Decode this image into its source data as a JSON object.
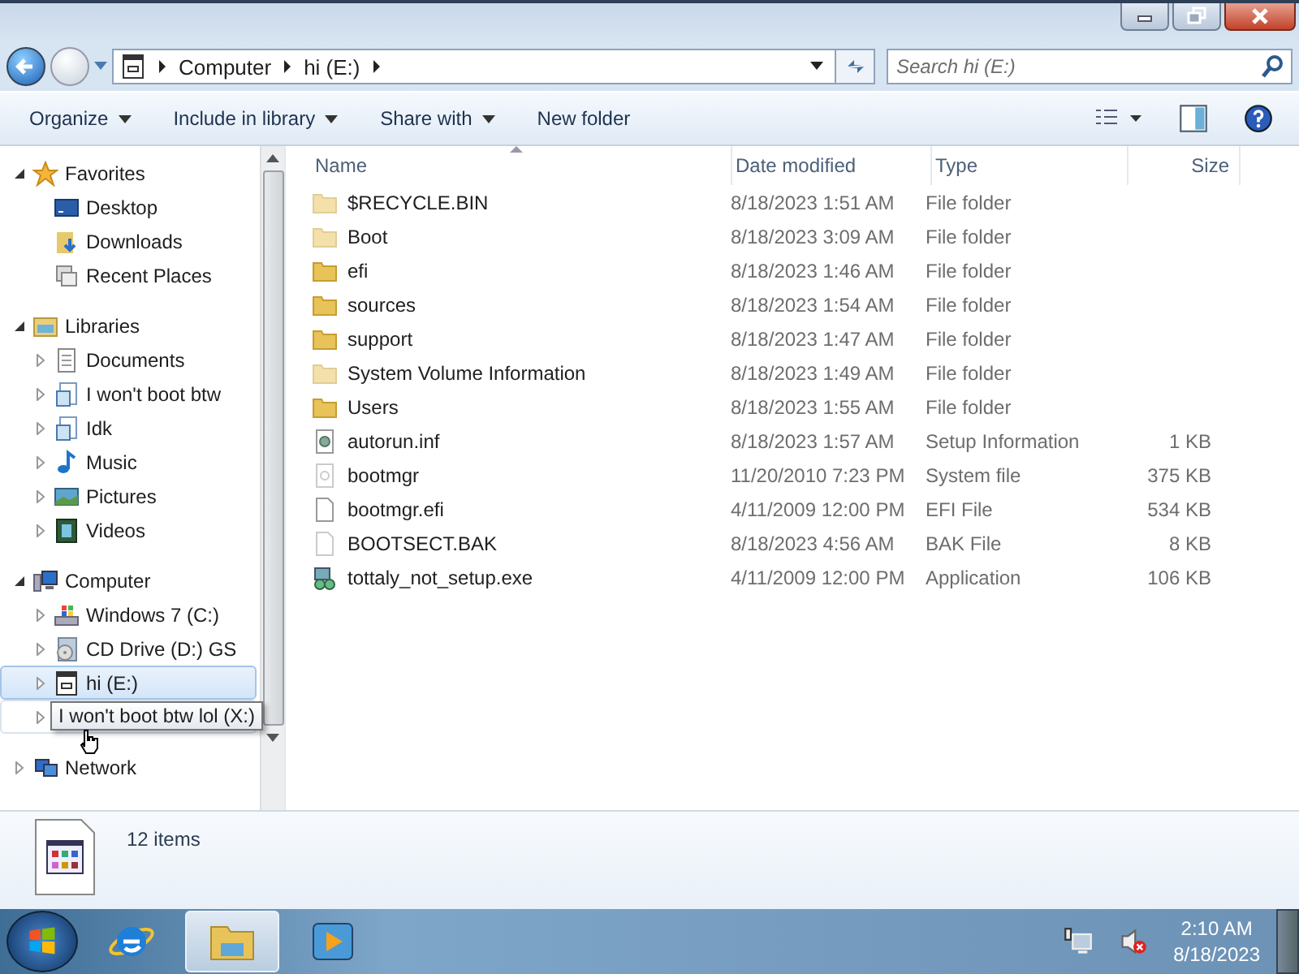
{
  "address": {
    "crumbs": [
      "Computer",
      "hi (E:)"
    ]
  },
  "search": {
    "placeholder": "Search hi (E:)"
  },
  "toolbar": {
    "buttons": [
      {
        "label": "Organize",
        "dropdown": true
      },
      {
        "label": "Include in library",
        "dropdown": true
      },
      {
        "label": "Share with",
        "dropdown": true
      },
      {
        "label": "New folder",
        "dropdown": false
      }
    ]
  },
  "sidebar": {
    "groups": [
      {
        "label": "Favorites",
        "kind": "star",
        "expanded": true,
        "children": [
          {
            "label": "Desktop",
            "kind": "desktop",
            "has_children": false,
            "selected": false
          },
          {
            "label": "Downloads",
            "kind": "downloads",
            "has_children": false,
            "selected": false
          },
          {
            "label": "Recent Places",
            "kind": "recent",
            "has_children": false,
            "selected": false
          }
        ]
      },
      {
        "label": "Libraries",
        "kind": "library",
        "expanded": true,
        "children": [
          {
            "label": "Documents",
            "kind": "document",
            "has_children": true,
            "selected": false
          },
          {
            "label": "I won't boot btw",
            "kind": "library-item",
            "has_children": true,
            "selected": false
          },
          {
            "label": "Idk",
            "kind": "library-item",
            "has_children": true,
            "selected": false
          },
          {
            "label": "Music",
            "kind": "music",
            "has_children": true,
            "selected": false
          },
          {
            "label": "Pictures",
            "kind": "pictures",
            "has_children": true,
            "selected": false
          },
          {
            "label": "Videos",
            "kind": "videos",
            "has_children": true,
            "selected": false
          }
        ]
      },
      {
        "label": "Computer",
        "kind": "computer",
        "expanded": true,
        "children": [
          {
            "label": "Windows 7 (C:)",
            "kind": "hdd-windows",
            "has_children": true,
            "selected": false
          },
          {
            "label": "CD Drive (D:) GS",
            "kind": "cd",
            "has_children": true,
            "selected": false
          },
          {
            "label": "hi (E:)",
            "kind": "app-drive",
            "has_children": true,
            "selected": true
          },
          {
            "tooltip": "I won't boot btw lol (X:)",
            "kind": "drive",
            "has_children": true,
            "selected": false,
            "hovered": true
          }
        ]
      },
      {
        "label": "Network",
        "kind": "network",
        "expanded": false
      }
    ]
  },
  "table": {
    "columns": [
      "Name",
      "Date modified",
      "Type",
      "Size"
    ],
    "rows": [
      {
        "name": "$RECYCLE.BIN",
        "date": "8/18/2023 1:51 AM",
        "type": "File folder",
        "kind": "folder",
        "hidden": true
      },
      {
        "name": "Boot",
        "date": "8/18/2023 3:09 AM",
        "type": "File folder",
        "kind": "folder",
        "hidden": true
      },
      {
        "name": "efi",
        "date": "8/18/2023 1:46 AM",
        "type": "File folder",
        "kind": "folder",
        "hidden": false
      },
      {
        "name": "sources",
        "date": "8/18/2023 1:54 AM",
        "type": "File folder",
        "kind": "folder",
        "hidden": false
      },
      {
        "name": "support",
        "date": "8/18/2023 1:47 AM",
        "type": "File folder",
        "kind": "folder",
        "hidden": false
      },
      {
        "name": "System Volume Information",
        "date": "8/18/2023 1:49 AM",
        "type": "File folder",
        "kind": "folder",
        "hidden": true
      },
      {
        "name": "Users",
        "date": "8/18/2023 1:55 AM",
        "type": "File folder",
        "kind": "folder",
        "hidden": false
      },
      {
        "name": "autorun.inf",
        "date": "8/18/2023 1:57 AM",
        "type": "Setup Information",
        "size": "1 KB",
        "kind": "settings",
        "hidden": false
      },
      {
        "name": "bootmgr",
        "date": "11/20/2010 7:23 PM",
        "type": "System file",
        "size": "375 KB",
        "kind": "system",
        "hidden": true
      },
      {
        "name": "bootmgr.efi",
        "date": "4/11/2009 12:00 PM",
        "type": "EFI File",
        "size": "534 KB",
        "kind": "blank",
        "hidden": false
      },
      {
        "name": "BOOTSECT.BAK",
        "date": "8/18/2023 4:56 AM",
        "type": "BAK File",
        "size": "8 KB",
        "kind": "blank",
        "hidden": true
      },
      {
        "name": "tottaly_not_setup.exe",
        "date": "4/11/2009 12:00 PM",
        "type": "Application",
        "size": "106 KB",
        "kind": "setup",
        "hidden": false
      }
    ]
  },
  "status": {
    "count": "12 items"
  },
  "taskbar": {
    "apps": [
      {
        "kind": "ie",
        "active": false
      },
      {
        "kind": "explorer",
        "active": true
      },
      {
        "kind": "media",
        "active": false
      }
    ],
    "time": "2:10 AM",
    "date": "8/18/2023"
  }
}
